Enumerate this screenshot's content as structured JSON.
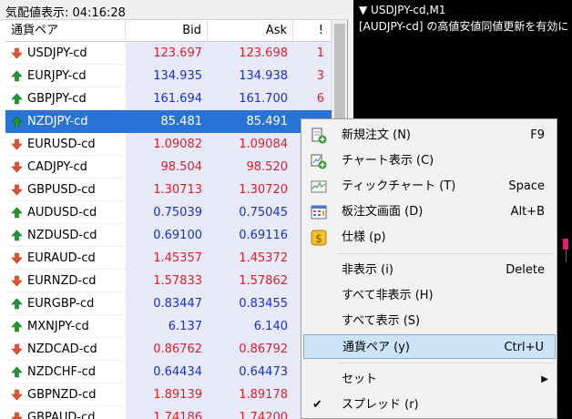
{
  "market_watch": {
    "title": "気配値表示: 04:16:28",
    "columns": {
      "symbol": "通貨ペア",
      "bid": "Bid",
      "ask": "Ask",
      "spread": "!"
    },
    "rows": [
      {
        "symbol": "USDJPY-cd",
        "bid": "123.697",
        "ask": "123.698",
        "x": "1",
        "dir": "down",
        "color": "red"
      },
      {
        "symbol": "EURJPY-cd",
        "bid": "134.935",
        "ask": "134.938",
        "x": "3",
        "dir": "up",
        "color": "blue"
      },
      {
        "symbol": "GBPJPY-cd",
        "bid": "161.694",
        "ask": "161.700",
        "x": "6",
        "dir": "up",
        "color": "blue"
      },
      {
        "symbol": "NZDJPY-cd",
        "bid": "85.481",
        "ask": "85.491",
        "x": "",
        "dir": "up",
        "color": "blue",
        "selected": true
      },
      {
        "symbol": "EURUSD-cd",
        "bid": "1.09082",
        "ask": "1.09084",
        "x": "",
        "dir": "down",
        "color": "red"
      },
      {
        "symbol": "CADJPY-cd",
        "bid": "98.504",
        "ask": "98.520",
        "x": "",
        "dir": "down",
        "color": "red"
      },
      {
        "symbol": "GBPUSD-cd",
        "bid": "1.30713",
        "ask": "1.30720",
        "x": "",
        "dir": "down",
        "color": "red"
      },
      {
        "symbol": "AUDUSD-cd",
        "bid": "0.75039",
        "ask": "0.75045",
        "x": "",
        "dir": "up",
        "color": "blue"
      },
      {
        "symbol": "NZDUSD-cd",
        "bid": "0.69100",
        "ask": "0.69116",
        "x": "",
        "dir": "up",
        "color": "blue"
      },
      {
        "symbol": "EURAUD-cd",
        "bid": "1.45357",
        "ask": "1.45372",
        "x": "",
        "dir": "down",
        "color": "red"
      },
      {
        "symbol": "EURNZD-cd",
        "bid": "1.57833",
        "ask": "1.57862",
        "x": "",
        "dir": "down",
        "color": "red"
      },
      {
        "symbol": "EURGBP-cd",
        "bid": "0.83447",
        "ask": "0.83455",
        "x": "",
        "dir": "up",
        "color": "blue"
      },
      {
        "symbol": "MXNJPY-cd",
        "bid": "6.137",
        "ask": "6.140",
        "x": "",
        "dir": "up",
        "color": "blue"
      },
      {
        "symbol": "NZDCAD-cd",
        "bid": "0.86762",
        "ask": "0.86792",
        "x": "",
        "dir": "down",
        "color": "red"
      },
      {
        "symbol": "NZDCHF-cd",
        "bid": "0.64434",
        "ask": "0.64473",
        "x": "",
        "dir": "up",
        "color": "blue"
      },
      {
        "symbol": "GBPNZD-cd",
        "bid": "1.89139",
        "ask": "1.89178",
        "x": "",
        "dir": "down",
        "color": "red"
      },
      {
        "symbol": "GBPAUD-cd",
        "bid": "1.74186",
        "ask": "1.74200",
        "x": "",
        "dir": "down",
        "color": "red"
      }
    ]
  },
  "chart": {
    "title": "▼ USDJPY-cd,M1",
    "message": "[AUDJPY-cd] の高値安値同値更新を有効に"
  },
  "context_menu": {
    "items": [
      {
        "label": "新規注文 (N)",
        "shortcut": "F9",
        "icon": "new-order-icon"
      },
      {
        "label": "チャート表示 (C)",
        "shortcut": "",
        "icon": "chart-window-icon"
      },
      {
        "label": "ティックチャート (T)",
        "shortcut": "Space",
        "icon": "tick-chart-icon"
      },
      {
        "label": "板注文画面 (D)",
        "shortcut": "Alt+B",
        "icon": "depth-of-market-icon"
      },
      {
        "label": "仕様 (p)",
        "shortcut": "",
        "icon": "specification-icon"
      },
      {
        "label": "非表示 (i)",
        "shortcut": "Delete"
      },
      {
        "label": "すべて非表示 (H)",
        "shortcut": ""
      },
      {
        "label": "すべて表示 (S)",
        "shortcut": ""
      },
      {
        "label": "通貨ペア (y)",
        "shortcut": "Ctrl+U",
        "highlighted": true
      },
      {
        "label": "セット",
        "shortcut": "",
        "submenu": true
      },
      {
        "label": "スプレッド (r)",
        "shortcut": "",
        "checked": true
      }
    ]
  },
  "colors": {
    "up_arrow": "#1e9a2e",
    "down_arrow": "#e8502a",
    "bid_ask_red": "#e01e28",
    "bid_ask_blue": "#1a2fd0",
    "selection": "#2a73d6",
    "menu_highlight": "#cce4f7"
  }
}
